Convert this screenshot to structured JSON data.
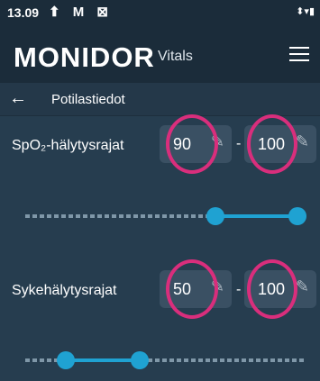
{
  "status": {
    "time": "13.09",
    "icons_left": "⬆ M ⊠",
    "icons_right": "⬍▾▮"
  },
  "header": {
    "brand": "MONIDOR",
    "sub": "Vitals"
  },
  "nav": {
    "title": "Potilastiedot"
  },
  "spo2": {
    "label": "SpO₂-hälytysrajat",
    "min": "90",
    "max": "100",
    "dash": "-",
    "slider_min_fraction": 0.69,
    "slider_max_fraction": 1.0
  },
  "hr": {
    "label": "Sykehälytysrajat",
    "min": "50",
    "max": "100",
    "dash": "-",
    "slider_min_fraction": 0.12,
    "slider_max_fraction": 0.4
  },
  "colors": {
    "accent": "#1fa2d2",
    "highlight": "#d92e7c",
    "field_bg": "#3a5063",
    "background": "#263d4f"
  },
  "icons": {
    "back": "arrow-left-icon",
    "menu": "hamburger-menu-icon",
    "edit": "pencil-icon"
  }
}
